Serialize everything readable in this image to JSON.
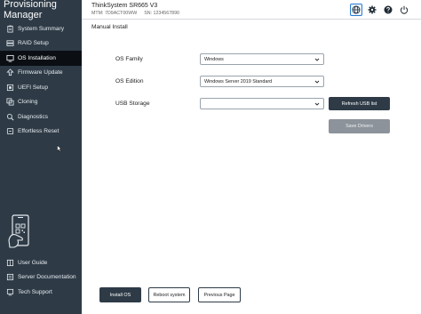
{
  "app": {
    "title": "Provisioning Manager"
  },
  "sidebar": {
    "items": [
      {
        "label": "System Summary",
        "icon": "clipboard-icon"
      },
      {
        "label": "RAID Setup",
        "icon": "raid-icon"
      },
      {
        "label": "OS Installation",
        "icon": "os-install-icon",
        "active": true
      },
      {
        "label": "Firmware Update",
        "icon": "firmware-icon"
      },
      {
        "label": "UEFI Setup",
        "icon": "uefi-icon"
      },
      {
        "label": "Cloning",
        "icon": "cloning-icon"
      },
      {
        "label": "Diagnostics",
        "icon": "diagnostics-icon"
      },
      {
        "label": "Effortless Reset",
        "icon": "reset-icon"
      }
    ],
    "help": [
      {
        "label": "User Guide",
        "icon": "book-icon"
      },
      {
        "label": "Server Documentation",
        "icon": "document-icon"
      },
      {
        "label": "Tech Support",
        "icon": "support-icon"
      }
    ]
  },
  "header": {
    "model": "ThinkSystem SR665 V3",
    "mtm": "MTM: 7D9ACT00WW",
    "sn": "SN: 1234567890",
    "icons": [
      "globe-icon",
      "gear-icon",
      "help-icon",
      "power-icon"
    ]
  },
  "main": {
    "title": "Manual Install",
    "os_family": {
      "label": "OS Family",
      "value": "Windows"
    },
    "os_edition": {
      "label": "OS Edition",
      "value": "Windows Server 2019 Standard"
    },
    "usb_storage": {
      "label": "USB Storage",
      "value": ""
    },
    "refresh_usb_label": "Refresh USB list",
    "save_drivers_label": "Save Drivers"
  },
  "footer": {
    "install_label": "Install OS",
    "reboot_label": "Reboot system",
    "previous_label": "Previous Page"
  },
  "colors": {
    "sidebar_bg": "#2e3b47",
    "active_bg": "#0b0f13",
    "accent": "#2a7bd1",
    "button_dark": "#2e3b47",
    "button_disabled": "#8c939a"
  }
}
